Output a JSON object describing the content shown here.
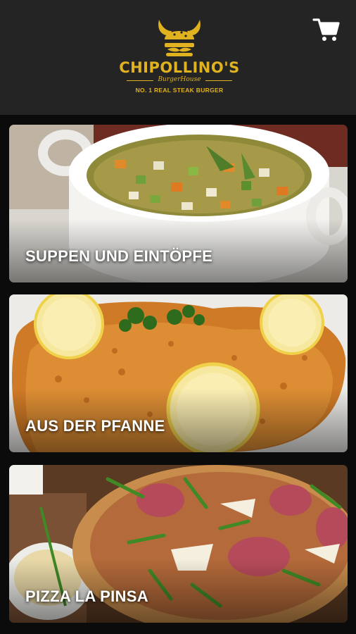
{
  "header": {
    "brand": "CHIPOLLINO'S",
    "tagline": "BurgerHouse",
    "subtitle": "NO. 1 REAL STEAK BURGER",
    "logo_icon": "viking-burger-icon",
    "cart_icon": "shopping-cart-icon"
  },
  "colors": {
    "header_bg": "#242424",
    "page_bg": "#0b0b0b",
    "brand_gold": "#e0b21f",
    "label_text": "#ffffff"
  },
  "categories": [
    {
      "label": "SUPPEN UND EINTÖPFE",
      "image": "vegetable-soup-photo"
    },
    {
      "label": "AUS DER PFANNE",
      "image": "schnitzel-with-lemon-photo"
    },
    {
      "label": "PIZZA LA PINSA",
      "image": "prosciutto-rucola-pizza-photo"
    }
  ]
}
